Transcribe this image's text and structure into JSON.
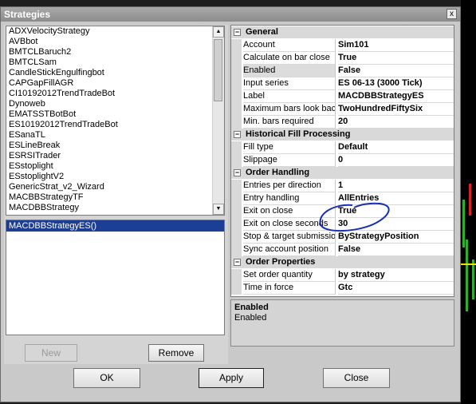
{
  "window": {
    "title": "Strategies",
    "close_glyph": "x"
  },
  "strategy_list": {
    "items": [
      "ADXVelocityStrategy",
      "AVBbot",
      "BMTCLBaruch2",
      "BMTCLSam",
      "CandleStickEngulfingbot",
      "CAPGapFillAGR",
      "CI10192012TrendTradeBot",
      "Dynoweb",
      "EMATSSTBotBot",
      "ES10192012TrendTradeBot",
      "ESanaTL",
      "ESLineBreak",
      "ESRSITrader",
      "ESstoplight",
      "ESstoplightV2",
      "GenericStrat_v2_Wizard",
      "MACBBStrategyTF",
      "MACDBBStrategy"
    ],
    "scroll_up": "▲",
    "scroll_down": "▼"
  },
  "selected_strategies": {
    "items": [
      "MACDBBStrategyES()"
    ]
  },
  "buttons": {
    "new": "New",
    "remove": "Remove",
    "ok": "OK",
    "apply": "Apply",
    "close": "Close"
  },
  "categories": [
    {
      "label": "General",
      "expander": "−",
      "rows": [
        {
          "name": "Account",
          "value": "Sim101"
        },
        {
          "name": "Calculate on bar close",
          "value": "True"
        },
        {
          "name": "Enabled",
          "value": "False",
          "selected": true
        },
        {
          "name": "Input series",
          "value": "ES 06-13 (3000 Tick)"
        },
        {
          "name": "Label",
          "value": "MACDBBStrategyES"
        },
        {
          "name": "Maximum bars look back",
          "value": "TwoHundredFiftySix"
        },
        {
          "name": "Min. bars required",
          "value": "20"
        }
      ]
    },
    {
      "label": "Historical Fill Processing",
      "expander": "−",
      "rows": [
        {
          "name": "Fill type",
          "value": "Default"
        },
        {
          "name": "Slippage",
          "value": "0"
        }
      ]
    },
    {
      "label": "Order Handling",
      "expander": "−",
      "rows": [
        {
          "name": "Entries per direction",
          "value": "1"
        },
        {
          "name": "Entry handling",
          "value": "AllEntries"
        },
        {
          "name": "Exit on close",
          "value": "True"
        },
        {
          "name": "Exit on close seconds",
          "value": "30"
        },
        {
          "name": "Stop & target submission",
          "value": "ByStrategyPosition"
        },
        {
          "name": "Sync account position",
          "value": "False"
        }
      ]
    },
    {
      "label": "Order Properties",
      "expander": "−",
      "rows": [
        {
          "name": "Set order quantity",
          "value": "by strategy"
        },
        {
          "name": "Time in force",
          "value": "Gtc"
        }
      ]
    }
  ],
  "description": {
    "title": "Enabled",
    "text": "Enabled"
  },
  "colors": {
    "annotation": "#1a2fb8",
    "selection": "#1c3f95",
    "candle_up": "#2fae2f",
    "candle_down": "#d22222"
  }
}
